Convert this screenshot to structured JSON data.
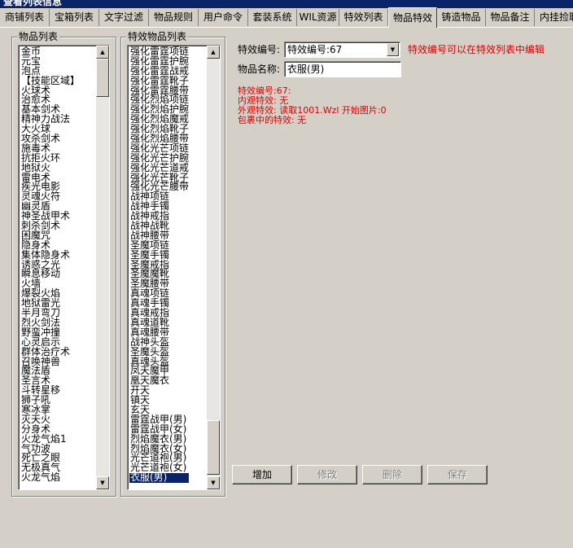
{
  "window": {
    "title": "查看列表信息"
  },
  "tabs": [
    {
      "label": "商铺列表"
    },
    {
      "label": "宝箱列表"
    },
    {
      "label": "文字过滤"
    },
    {
      "label": "物品规则"
    },
    {
      "label": "用户命令"
    },
    {
      "label": "套装系统"
    },
    {
      "label": "WIL资源"
    },
    {
      "label": "特效列表"
    },
    {
      "label": "物品特效",
      "active": true
    },
    {
      "label": "铸造物品"
    },
    {
      "label": "物品备注"
    },
    {
      "label": "内挂捡取"
    }
  ],
  "item_list": {
    "title": "物品列表",
    "items": [
      "金币",
      "元宝",
      "泡点",
      "【技能区域】",
      "火球术",
      "治愈术",
      "基本剑术",
      "精神力战法",
      "大火球",
      "攻杀剑术",
      "施毒术",
      "抗拒火环",
      "地狱火",
      "雷电术",
      "疾光电影",
      "灵魂火符",
      "幽灵盾",
      "神圣战甲术",
      "刺杀剑术",
      "困魔咒",
      "隐身术",
      "集体隐身术",
      "诱惑之光",
      "瞬息移动",
      "火墙",
      "爆裂火焰",
      "地狱雷光",
      "半月弯刀",
      "烈火剑法",
      "野蛮冲撞",
      "心灵启示",
      "群体治疗术",
      "召唤神兽",
      "魔法盾",
      "圣言术",
      "斗转星移",
      "狮子吼",
      "寒冰掌",
      "灭天火",
      "分身术",
      "火龙气焰1",
      "气功波",
      "死亡之眼",
      "无极真气",
      "火龙气焰"
    ]
  },
  "effect_list": {
    "title": "特效物品列表",
    "items": [
      "强化雷霆项链",
      "强化雷霆护腕",
      "强化雷霆战戒",
      "强化雷霆靴子",
      "强化雷霆腰带",
      "强化烈焰项链",
      "强化烈焰护腕",
      "强化烈焰魔戒",
      "强化烈焰靴子",
      "强化烈焰腰带",
      "强化光芒项链",
      "强化光芒护腕",
      "强化光芒道戒",
      "强化光芒靴子",
      "强化光芒腰带",
      "战神项链",
      "战神手镯",
      "战神戒指",
      "战神战靴",
      "战神腰带",
      "圣魔项链",
      "圣魔手镯",
      "圣魔戒指",
      "圣魔魔靴",
      "圣魔腰带",
      "真魂项链",
      "真魂手镯",
      "真魂戒指",
      "真魂道靴",
      "真魂腰带",
      "战神头盔",
      "圣魔头盔",
      "真魂头盔",
      "凤天魔甲",
      "凰天魔衣",
      "开天",
      "镇天",
      "玄天",
      "雷霆战甲(男)",
      "雷霆战甲(女)",
      "烈焰魔衣(男)",
      "烈焰魔衣(女)",
      "光芒道袍(男)",
      "光芒道袍(女)",
      "衣服(男)"
    ],
    "selected": "衣服(男)"
  },
  "form": {
    "effect_id_label": "特效编号:",
    "effect_id_value": "特效编号:67",
    "effect_hint": "特效编号可以在特效列表中编辑",
    "item_name_label": "物品名称:",
    "item_name_value": "衣服(男)"
  },
  "info": {
    "line1": "特效编号:67:",
    "line2": "内观特效: 无",
    "line3": "外观特效: 读取1001.Wzl 开始图片:0",
    "line4": "包裹中的特效: 无"
  },
  "buttons": {
    "add": "增加",
    "edit": "修改",
    "delete": "删除",
    "save": "保存"
  },
  "icons": [
    "arrow-up-icon",
    "arrow-down-icon",
    "dropdown-arrow-icon"
  ],
  "colors": {
    "title_bg": "#0a246a",
    "hint_red": "#e00000",
    "selection_bg": "#0a246a",
    "face": "#d4d0c8"
  }
}
